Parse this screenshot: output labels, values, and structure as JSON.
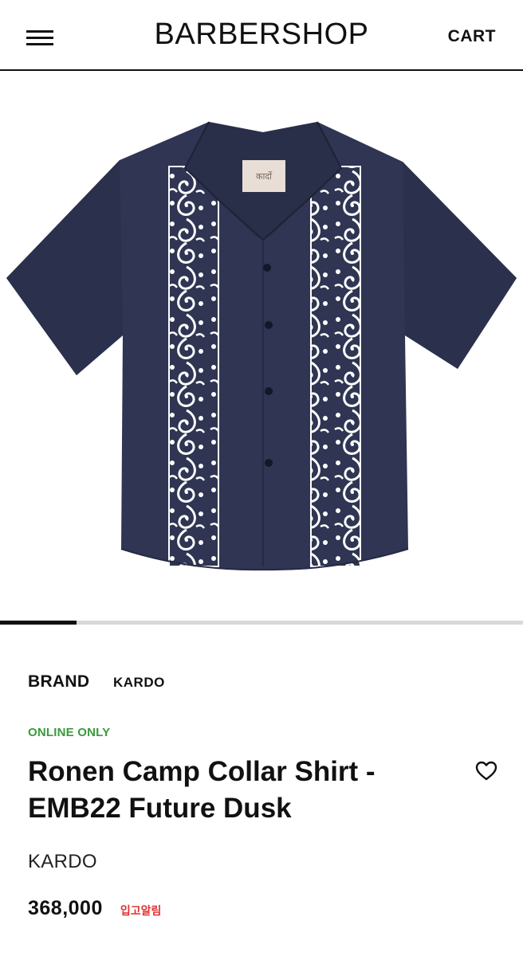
{
  "header": {
    "menu_icon": "hamburger-menu-icon",
    "logo": "BARBERSHOP",
    "cart_label": "CART"
  },
  "gallery": {
    "image": "navy short-sleeve camp collar shirt with white paisley embroidery panels",
    "label_tag_text": "कार्दो",
    "progress": 0.146
  },
  "product": {
    "brand_label": "BRAND",
    "brand_value": "KARDO",
    "badge": "ONLINE ONLY",
    "title": "Ronen Camp Collar Shirt - EMB22 Future Dusk",
    "brand_name": "KARDO",
    "price": "368,000",
    "restock_alert": "입고알림",
    "wishlist_icon": "heart-outline-icon"
  },
  "colors": {
    "shirt": "#2f3552",
    "embroidery": "#ffffff",
    "online_badge": "#3a9a3a",
    "restock": "#e03131"
  }
}
